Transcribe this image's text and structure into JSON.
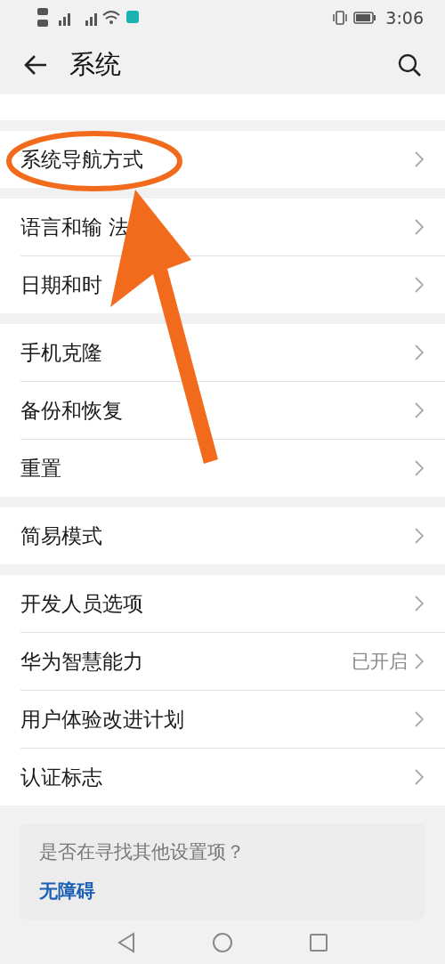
{
  "status_bar": {
    "time": "3:06"
  },
  "header": {
    "title": "系统"
  },
  "groups": [
    [
      {
        "label": "系统导航方式"
      }
    ],
    [
      {
        "label": "语言和输 法"
      },
      {
        "label": "日期和时"
      }
    ],
    [
      {
        "label": "手机克隆"
      },
      {
        "label": "备份和恢复"
      },
      {
        "label": "重置"
      }
    ],
    [
      {
        "label": "简易模式"
      }
    ],
    [
      {
        "label": "开发人员选项"
      },
      {
        "label": "华为智慧能力",
        "value": "已开启"
      },
      {
        "label": "用户体验改进计划"
      },
      {
        "label": "认证标志"
      }
    ]
  ],
  "hint_card": {
    "question": "是否在寻找其他设置项？",
    "link": "无障碍"
  }
}
